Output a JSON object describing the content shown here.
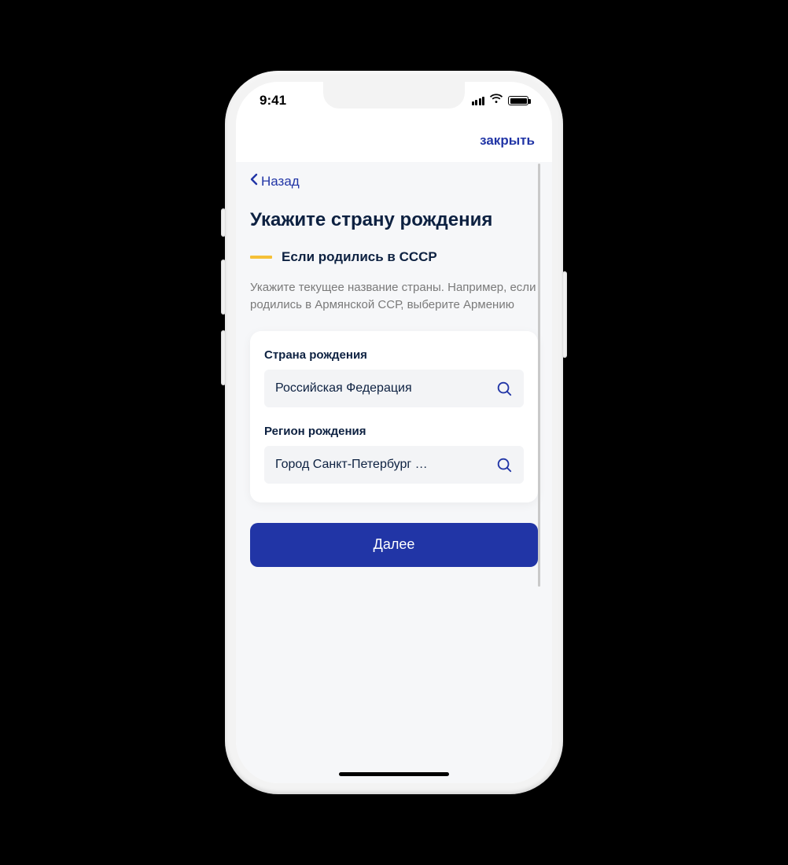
{
  "status": {
    "time": "9:41"
  },
  "nav": {
    "close_label": "закрыть",
    "back_label": "Назад"
  },
  "page": {
    "title": "Укажите страну рождения",
    "subheading": "Если родились в СССР",
    "hint": "Укажите текущее название страны. Например, если родились в Армянской ССР, выберите Армению"
  },
  "form": {
    "country": {
      "label": "Страна рождения",
      "value": "Российская Федерация"
    },
    "region": {
      "label": "Регион рождения",
      "value": "Город Санкт-Петербург …"
    },
    "next_label": "Далее"
  }
}
